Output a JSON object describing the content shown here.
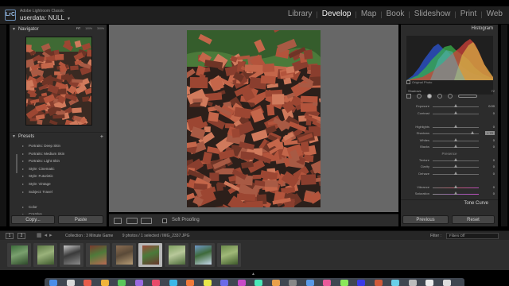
{
  "identity": {
    "logo": "LrC",
    "app_name": "Adobe Lightroom Classic",
    "user": "userdata: NULL"
  },
  "modules": [
    "Library",
    "Develop",
    "Map",
    "Book",
    "Slideshow",
    "Print",
    "Web"
  ],
  "active_module": "Develop",
  "navigator": {
    "title": "Navigator",
    "zoom_options": [
      "FIT",
      "100%",
      "300%"
    ],
    "selected_zoom": "FIT"
  },
  "presets": {
    "title": "Presets",
    "items": [
      "Portraits: Deep Skin",
      "Portraits: Medium Skin",
      "Portraits: Light Skin",
      "Style: Cinematic",
      "Style: Futuristic",
      "Style: Vintage",
      "Subject: Travel",
      "",
      "Color",
      "Creative"
    ]
  },
  "left_buttons": {
    "copy": "Copy...",
    "paste": "Paste"
  },
  "toolbar": {
    "soft_proofing": "Soft Proofing"
  },
  "histogram": {
    "title": "Histogram",
    "readout_label": "Shadows",
    "readout_value": "72",
    "original_photo": "Original Photo"
  },
  "sliders": [
    {
      "label": "Exposure",
      "value": "0.00",
      "pos": 0.5
    },
    {
      "label": "Contrast",
      "value": "0",
      "pos": 0.5
    },
    {
      "label": "",
      "value": "",
      "pos": null
    },
    {
      "label": "Highlights",
      "value": "0",
      "pos": 0.5
    },
    {
      "label": "Shadows",
      "value": "+ 72",
      "pos": 0.86,
      "highlight": true
    },
    {
      "label": "Whites",
      "value": "0",
      "pos": 0.5
    },
    {
      "label": "Blacks",
      "value": "0",
      "pos": 0.5
    }
  ],
  "presence": {
    "title": "Presence",
    "sliders": [
      {
        "label": "Texture",
        "value": "0",
        "pos": 0.5
      },
      {
        "label": "Clarity",
        "value": "0",
        "pos": 0.5
      },
      {
        "label": "Dehaze",
        "value": "0",
        "pos": 0.5
      },
      {
        "label": "",
        "value": "",
        "pos": null
      },
      {
        "label": "Vibrance",
        "value": "0",
        "pos": 0.5,
        "style": "vib"
      },
      {
        "label": "Saturation",
        "value": "0",
        "pos": 0.5,
        "style": "sat"
      }
    ]
  },
  "tone_curve": {
    "title": "Tone Curve"
  },
  "right_buttons": {
    "previous": "Previous",
    "reset": "Reset"
  },
  "filmstrip_bar": {
    "screen_1": "1",
    "screen_2": "2",
    "collection": "Collection : 3 Minute Game",
    "count": "9 photos / 1 selected / IMG_2337.JPG",
    "filter_label": "Filter :",
    "filter_value": "Filters Off"
  },
  "filmstrip": {
    "selected_index": 5,
    "thumbs": [
      {
        "name": "thumb-1",
        "colors": [
          "#3b6b3a",
          "#7aa06e",
          "#2e4a2a"
        ]
      },
      {
        "name": "thumb-2",
        "colors": [
          "#5d7a45",
          "#9ab27b",
          "#3f5a2e"
        ]
      },
      {
        "name": "thumb-3",
        "colors": [
          "#c9c9c9",
          "#3a3a3a",
          "#8a8a8a"
        ]
      },
      {
        "name": "thumb-4",
        "colors": [
          "#7a3a2e",
          "#4f7a3a",
          "#b86a52"
        ]
      },
      {
        "name": "thumb-5",
        "colors": [
          "#8a6d52",
          "#5a4a38",
          "#b59a74"
        ]
      },
      {
        "name": "thumb-6",
        "colors": [
          "#9b4a3a",
          "#4a7a3a",
          "#6a3a2e"
        ]
      },
      {
        "name": "thumb-7",
        "colors": [
          "#7ea060",
          "#b8c89a",
          "#4d6b3a"
        ]
      },
      {
        "name": "thumb-8",
        "colors": [
          "#6f98c8",
          "#3e6a3a",
          "#c6d8ea"
        ]
      },
      {
        "name": "thumb-9",
        "colors": [
          "#6a8a4a",
          "#a0b878",
          "#3e5a2a"
        ]
      }
    ]
  },
  "colors": {
    "panel": "#2c2c2c",
    "canvas": "#676767",
    "accent_active_module": "#f0f0f0",
    "brick": "#b3543c"
  },
  "dock_icons": [
    "#4a8ee8",
    "#d9d9d9",
    "#e85c4a",
    "#f0b43a",
    "#5ac85a",
    "#9a6ae0",
    "#e84a6a",
    "#3ab8e8",
    "#f07a3a",
    "#e8e84a",
    "#6a6ae8",
    "#c84ac8",
    "#4ae8b8",
    "#e8a04a",
    "#888",
    "#5a9ae8",
    "#e85a9a",
    "#8ae85a",
    "#3a3ae8",
    "#d05a3a",
    "#6ad0e8",
    "#bcbcbc",
    "#eaeaea",
    "#dcdcdc"
  ]
}
